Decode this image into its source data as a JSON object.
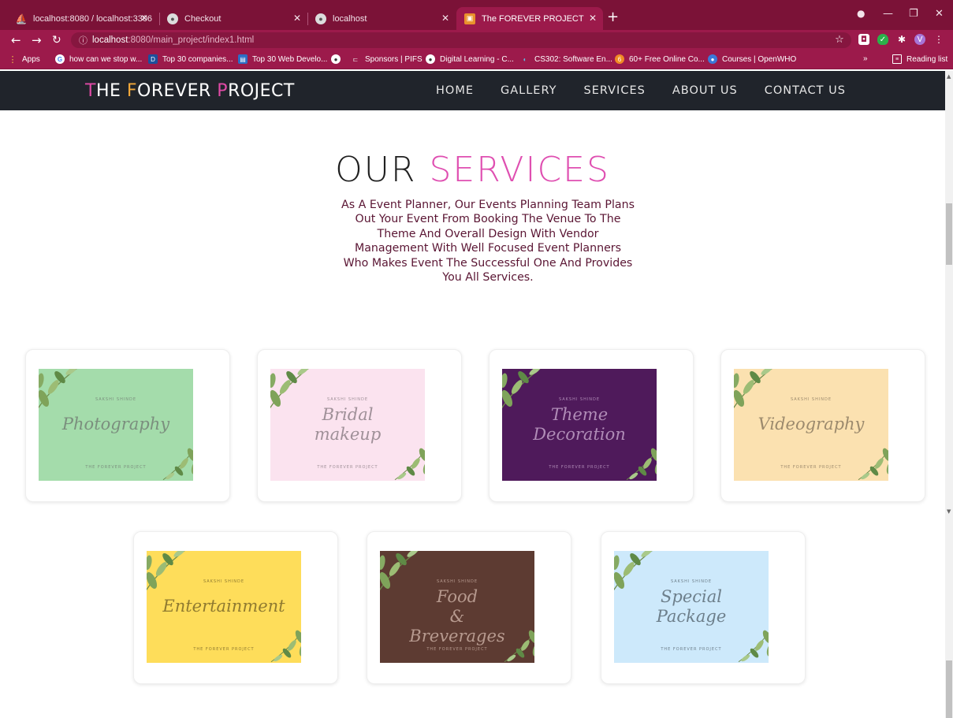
{
  "browser": {
    "tabs": [
      {
        "label": "localhost:8080 / localhost:3306 /",
        "icon": "phpmyadmin-icon",
        "color": "#e7a321"
      },
      {
        "label": "Checkout",
        "icon": "globe-icon",
        "color": "#6b6b6b"
      },
      {
        "label": "localhost",
        "icon": "globe-icon",
        "color": "#6b6b6b"
      },
      {
        "label": "The FOREVER PROJECT",
        "icon": "site-icon",
        "color": "#e9912c"
      }
    ],
    "url_host": "localhost",
    "url_path": ":8080/main_project/index1.html",
    "bookmarks": [
      {
        "label": "Apps",
        "icon": "apps-grid-icon"
      },
      {
        "label": "how can we stop w...",
        "icon": "google-icon"
      },
      {
        "label": "Top 30 companies...",
        "icon": "d-logo-icon"
      },
      {
        "label": "Top 30 Web Develo...",
        "icon": "site-icon"
      },
      {
        "label": "",
        "icon": "globe-icon"
      },
      {
        "label": "Sponsors | PIFS",
        "icon": "pifs-icon"
      },
      {
        "label": "Digital Learning - C...",
        "icon": "globe-icon"
      },
      {
        "label": "CS302: Software En...",
        "icon": "saylor-icon"
      },
      {
        "label": "60+ Free Online Co...",
        "icon": "course-icon"
      },
      {
        "label": "Courses | OpenWHO",
        "icon": "openwho-icon"
      }
    ],
    "reading_list": "Reading list",
    "overflow": "»",
    "profile_initial": "V"
  },
  "site": {
    "logo": {
      "t": "T",
      "he": "HE ",
      "f": "F",
      "orever": "OREVER ",
      "p": "P",
      "roject": "ROJECT"
    },
    "nav": [
      "HOME",
      "GALLERY",
      "SERVICES",
      "ABOUT US",
      "CONTACT US"
    ]
  },
  "services": {
    "title_plain": "OUR ",
    "title_accent": "SERVICES",
    "description": "As A Event Planner, Our Events Planning Team Plans Out Your Event From Booking The Venue To The Theme And Overall Design With Vendor Management With Well Focused Event Planners Who Makes Event The Successful One And Provides You All Services.",
    "cards": [
      {
        "script": "Photography",
        "author": "SAKSHI SHINDE",
        "brand": "THE FOREVER PROJECT",
        "bg": "#a4dcab",
        "ink": "#7b8f7e"
      },
      {
        "script": "Bridal makeup",
        "author": "SAKSHI SHINDE",
        "brand": "THE FOREVER PROJECT",
        "bg": "#fbe3ef",
        "ink": "#9f9098"
      },
      {
        "script": "Theme Decoration",
        "author": "SAKSHI SHINDE",
        "brand": "THE FOREVER PROJECT",
        "bg": "#4f1a5b",
        "ink": "#b08cb7"
      },
      {
        "script": "Videography",
        "author": "SAKSHI SHINDE",
        "brand": "THE FOREVER PROJECT",
        "bg": "#fbe1b0",
        "ink": "#9c8a6d"
      },
      {
        "script": "Entertainment",
        "author": "SAKSHI SHINDE",
        "brand": "THE FOREVER PROJECT",
        "bg": "#fedd5a",
        "ink": "#8f7a30"
      },
      {
        "script": "Food & Breverages",
        "author": "SAKSHI SHINDE",
        "brand": "THE FOREVER PROJECT",
        "bg": "#5d3b32",
        "ink": "#b79a8f"
      },
      {
        "script": "Special Package",
        "author": "SAKSHI SHINDE",
        "brand": "THE FOREVER PROJECT",
        "bg": "#cde9fb",
        "ink": "#6d7f8b"
      }
    ]
  }
}
